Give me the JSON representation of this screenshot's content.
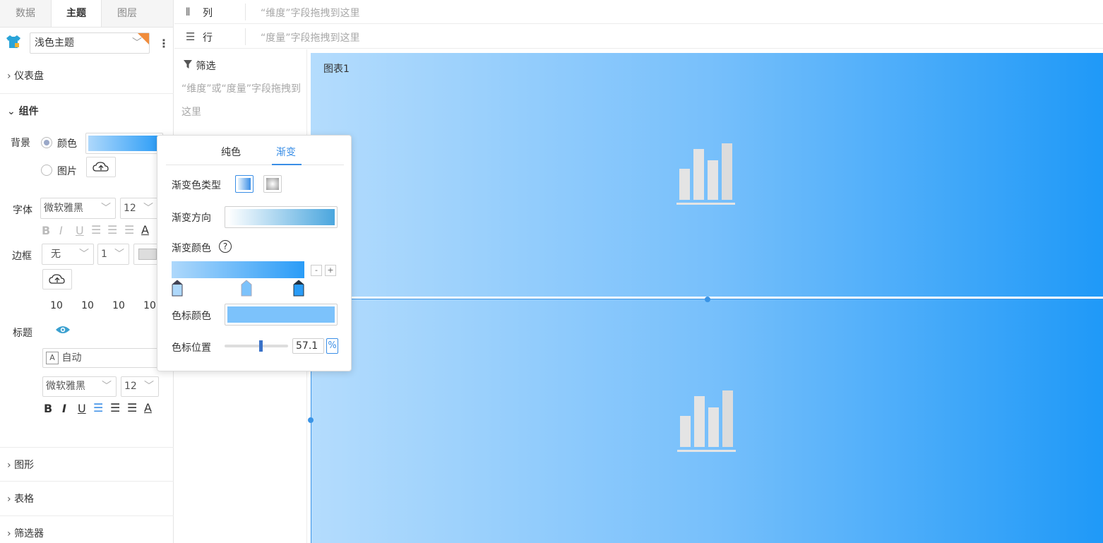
{
  "left_panel": {
    "tabs": [
      "数据",
      "主题",
      "图层"
    ],
    "theme": {
      "value": "浅色主题"
    },
    "sections": {
      "dashboard": "仪表盘",
      "component": "组件",
      "shape": "图形",
      "table": "表格",
      "filter": "筛选器"
    },
    "background": {
      "label": "背景",
      "color_option": "颜色",
      "image_option": "图片"
    },
    "font": {
      "label": "字体",
      "family": "微软雅黑",
      "size": "12"
    },
    "border": {
      "label": "边框",
      "style": "无",
      "width": "1",
      "paddings": [
        "10",
        "10",
        "10",
        "10"
      ]
    },
    "title": {
      "label": "标题",
      "align": "自动",
      "family": "微软雅黑",
      "size": "12"
    },
    "format_glyphs": {
      "bold": "B",
      "italic": "I",
      "underline": "U",
      "color": "A"
    }
  },
  "shelves": {
    "columns": {
      "label": "列",
      "placeholder": "“维度”字段拖拽到这里"
    },
    "rows": {
      "label": "行",
      "placeholder": "“度量”字段拖拽到这里"
    }
  },
  "filter": {
    "title": "筛选",
    "placeholder": "“维度”或“度量”字段拖拽到这里"
  },
  "canvas": {
    "chart_title": "图表1"
  },
  "popup": {
    "tabs": [
      "纯色",
      "渐变"
    ],
    "active_tab": "渐变",
    "gradient_type_label": "渐变色类型",
    "gradient_direction_label": "渐变方向",
    "gradient_colors_label": "渐变颜色",
    "stop_color_label": "色标颜色",
    "stop_position_label": "色标位置",
    "stop_position_value": "57.1",
    "stop_position_unit": "%",
    "help_glyph": "?",
    "minus": "-",
    "plus": "+",
    "stops": [
      0,
      57.1,
      100
    ],
    "stop_color": "#7cc2fb"
  },
  "colors": {
    "accent": "#3a8ee6",
    "gradient_start": "#aed8fb",
    "gradient_end": "#2a9cf7"
  }
}
